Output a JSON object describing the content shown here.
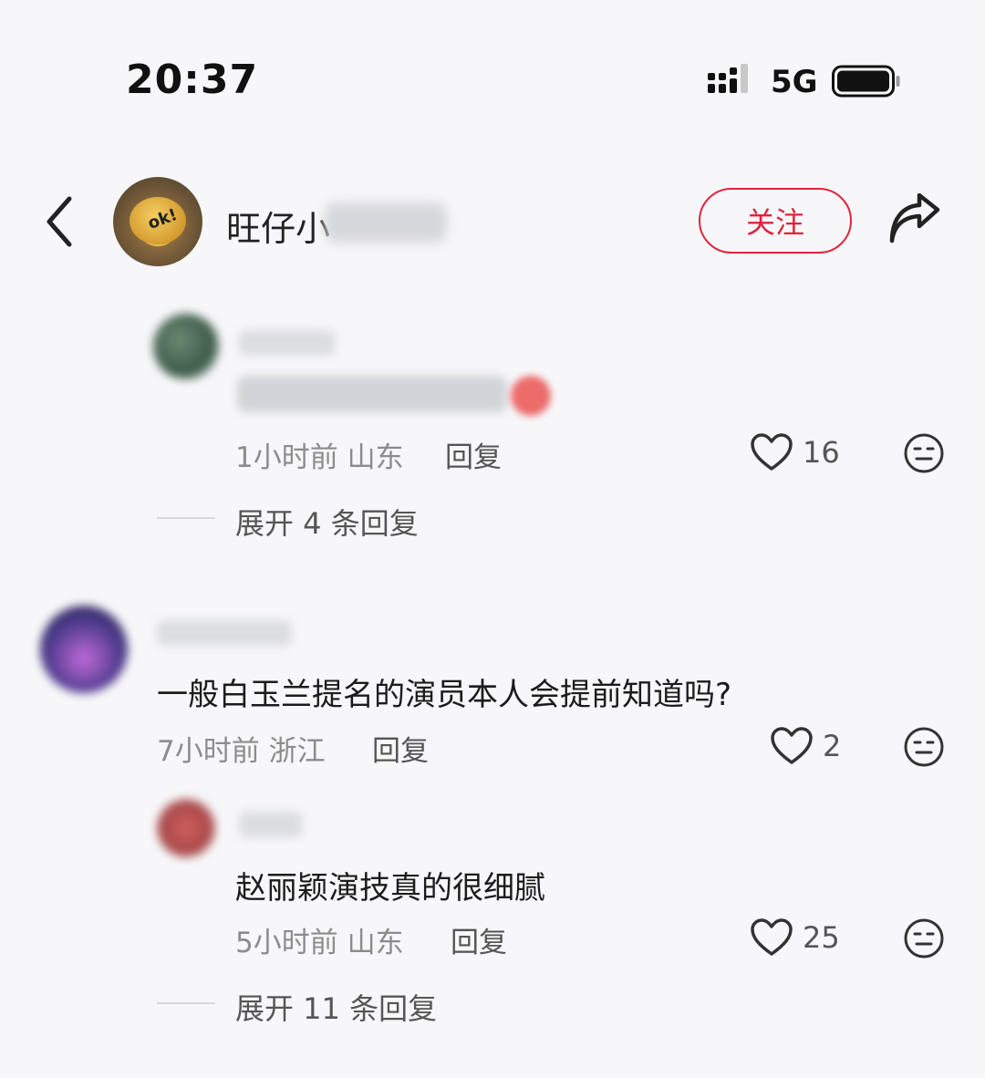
{
  "status_bar": {
    "time": "20:37",
    "network": "5G"
  },
  "header": {
    "author_name": "旺仔小",
    "follow_label": "关注"
  },
  "comments": [
    {
      "meta": "1小时前 山东",
      "reply_label": "回复",
      "likes": "16",
      "expand_label": "展开 4 条回复"
    },
    {
      "text": "一般白玉兰提名的演员本人会提前知道吗?",
      "meta": "7小时前 浙江",
      "reply_label": "回复",
      "likes": "2"
    },
    {
      "text": "赵丽颖演技真的很细腻",
      "meta": "5小时前 山东",
      "reply_label": "回复",
      "likes": "25",
      "expand_label": "展开 11 条回复"
    }
  ],
  "colors": {
    "accent": "#e0243c",
    "background": "#f7f7f9",
    "muted_text": "#8c8c8c"
  }
}
